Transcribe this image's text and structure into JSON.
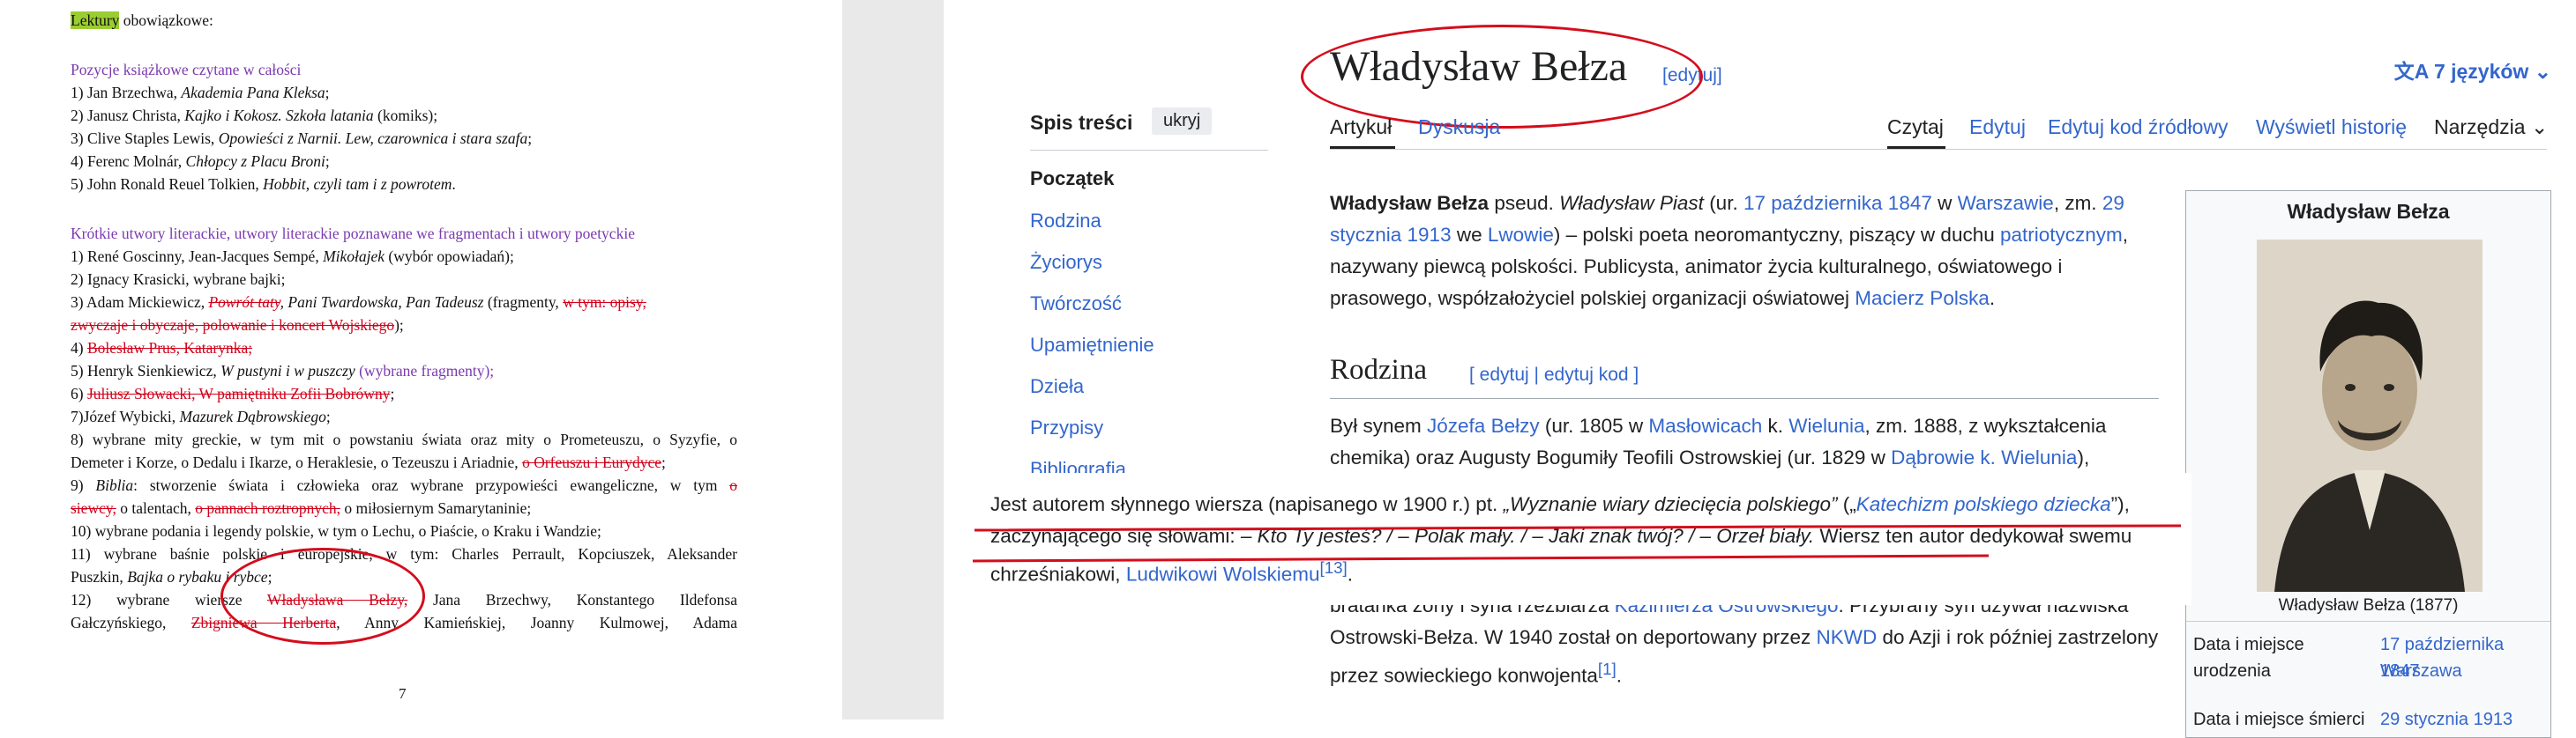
{
  "document": {
    "heading_highlight": "Lektury",
    "heading_rest": " obowiązkowe:",
    "section1_title": "Pozycje książkowe czytane w całości",
    "section1_items": [
      {
        "pre": "1) Jan Brzechwa, ",
        "title": "Akademia Pana Kleksa",
        "post": ";"
      },
      {
        "pre": "2) Janusz Christa, ",
        "title": "Kajko i Kokosz. Szkoła latania",
        "post": " (komiks);"
      },
      {
        "pre": "3) Clive Staples Lewis, ",
        "title": "Opowieści z Narnii. Lew, czarownica i stara szafa",
        "post": ";"
      },
      {
        "pre": "4) Ferenc Molnár, ",
        "title": "Chłopcy z Placu Broni",
        "post": ";"
      },
      {
        "pre": "5) John Ronald Reuel Tolkien, ",
        "title": "Hobbit, czyli tam i z powrotem",
        "post": "."
      }
    ],
    "section2_title": "Krótkie utwory literackie, utwory literackie poznawane we fragmentach i utwory poetyckie",
    "l1_pre": "1) René Goscinny, Jean-Jacques Sempé, ",
    "l1_title": "Mikołajek",
    "l1_post": " (wybór opowiadań);",
    "l2": "2) Ignacy Krasicki, wybrane bajki;",
    "l3_pre": "3) Adam Mickiewicz, ",
    "l3_strike1": "Powrót taty",
    "l3_mid": ", Pani Twardowska, Pan Tadeusz",
    "l3_post": " (fragmenty, ",
    "l3_strike2": "w tym: opisy,",
    "l3b_strike": "zwyczaje i obyczaje, polowanie i koncert Wojskiego",
    "l3b_post": ");",
    "l4_pre": "4) ",
    "l4_strike": "Bolesław Prus, Katarynka;",
    "l5_pre": "5) Henryk Sienkiewicz, ",
    "l5_title": "W pustyni i w puszczy",
    "l5_post": " (wybrane fragmenty);",
    "l6_pre": "6) ",
    "l6_strike": "Juliusz Słowacki, W pamiętniku Zofii Bobrówny",
    "l6_post": ";",
    "l7_pre": "7)Józef Wybicki, ",
    "l7_title": "Mazurek Dąbrowskiego",
    "l7_post": ";",
    "l8a": "8) wybrane mity greckie, w tym mit o powstaniu świata oraz mity o Prometeuszu, o Syzyfie, o",
    "l8b_pre": "Demeter i Korze, o Dedalu i Ikarze, o Heraklesie, o Tezeuszu i Ariadnie, ",
    "l8b_strike": "o Orfeuszu i Eurydyce",
    "l8b_post": ";",
    "l9a_pre": "9) ",
    "l9a_title": "Biblia",
    "l9a_post": ": stworzenie świata i człowieka oraz wybrane przypowieści ewangeliczne, w tym ",
    "l9a_strike": "o",
    "l9b_strike1": "siewcy,",
    "l9b_mid": " o talentach, ",
    "l9b_strike2": "o pannach roztropnych,",
    "l9b_post": " o miłosiernym Samarytaninie;",
    "l10": "10) wybrane podania i legendy polskie, w tym o Lechu, o Piaście, o Kraku i Wandzie;",
    "l11a": "11) wybrane baśnie polskie i europejskie, w tym: Charles Perrault, Kopciuszek, Aleksander",
    "l11b_pre": "Puszkin, ",
    "l11b_title": "Bajka o rybaku i rybce",
    "l11b_post": ";",
    "l12a_pre": "12) wybrane wiersze ",
    "l12a_strike": "Władysława Bełzy,",
    "l12a_post": " Jana Brzechwy, Konstantego Ildefonsa",
    "l12b_pre": "Gałczyńskiego, ",
    "l12b_strike": "Zbigniewa Herberta",
    "l12b_post": ", Anny Kamieńskiej, Joanny Kulmowej, Adama",
    "page_number": "7"
  },
  "wiki": {
    "title": "Władysław Bełza",
    "title_edit": "[edytuj]",
    "languages": "7 języków",
    "toc": {
      "title": "Spis treści",
      "hide_button": "ukryj",
      "items": [
        "Początek",
        "Rodzina",
        "Życiorys",
        "Twórczość",
        "Upamiętnienie",
        "Dzieła",
        "Przypisy",
        "Bibliografia"
      ]
    },
    "tabs": {
      "article": "Artykuł",
      "discussion": "Dyskusja",
      "read": "Czytaj",
      "edit": "Edytuj",
      "edit_source": "Edytuj kod źródłowy",
      "history": "Wyświetl historię",
      "tools": "Narzędzia"
    },
    "intro": {
      "name": "Władysław Bełza",
      "t1": " pseud. ",
      "pseud": "Władysław Piast",
      "t2": " (ur. ",
      "born_date": "17 października 1847",
      "t3": " w ",
      "born_place": "Warszawie",
      "t4": ", zm. ",
      "died_date": "29 stycznia 1913",
      "t5": " we ",
      "died_place": "Lwowie",
      "t6": ") – polski poeta neoromantyczny, piszący w duchu ",
      "patriotic": "patriotycznym",
      "t7": ", nazywany piewcą polskości. Publicysta, animator życia kulturalnego, oświatowego i prasowego, współzałożyciel polskiej organizacji oświatowej ",
      "org": "Macierz Polska",
      "t8": "."
    },
    "section_rodzina": "Rodzina",
    "section_rodzina_edit": "[ edytuj | edytuj kod ]",
    "rodzina_p1": {
      "t1": "Był synem ",
      "father": "Józefa Bełzy",
      "t2": " (ur. 1805 w ",
      "place1": "Masłowicach",
      "t3": " k. ",
      "place2": "Wielunia",
      "t4": ", zm. 1888, z wykształcenia chemika) oraz Augusty Bogumiły Teofili Ostrowskiej (ur. 1829 w ",
      "place3": "Dąbrowie k. Wielunia",
      "t5": "),"
    },
    "rodzina_p2": {
      "t1": "bratanka żony i syna rzeźbiarza ",
      "sculptor": "Kazimierza Ostrowskiego",
      "t2": ". Przybrany syn używał nazwiska Ostrowski-Bełza. W 1940 został on deportowany przez ",
      "nkwd": "NKWD",
      "t3": " do Azji i rok później zastrzelony przez sowieckiego konwojenta",
      "ref": "[1]",
      "t4": "."
    },
    "infobox": {
      "title": "Władysław Bełza",
      "caption": "Władysław Bełza (1877)",
      "birth_label": "Data i miejsce urodzenia",
      "birth_date": "17 października 1847",
      "birth_place": "Warszawa",
      "death_label": "Data i miejsce śmierci",
      "death_date": "29 stycznia 1913"
    }
  },
  "overlay": {
    "t1": "Jest autorem słynnego wiersza (napisanego w 1900 r.) pt. ",
    "poem": "„Wyznanie wiary dziecięcia polskiego”",
    "t2": " („",
    "alt": "Katechizm polskiego dziecka",
    "t3": "”), zaczynającego się słowami: ",
    "quote": "– Kto Ty jesteś? / – Polak mały. / – Jaki znak twój? / – Orzeł biały.",
    "t4": " Wiersz ten autor dedykował swemu chrześniakowi, ",
    "godson": "Ludwikowi Wolskiemu",
    "ref": "[13]",
    "t5": "."
  }
}
